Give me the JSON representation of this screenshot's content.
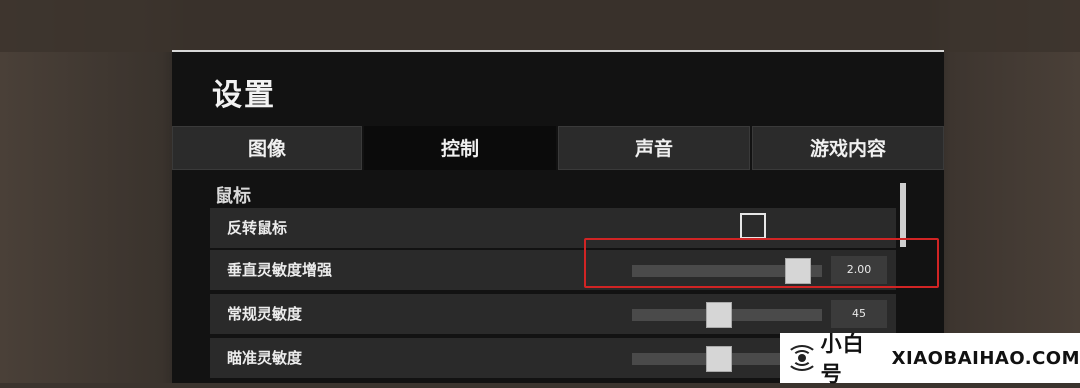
{
  "window": {
    "title": "设置"
  },
  "tabs": [
    {
      "label": "图像"
    },
    {
      "label": "控制"
    },
    {
      "label": "声音"
    },
    {
      "label": "游戏内容"
    }
  ],
  "active_tab": "控制",
  "section": {
    "title": "鼠标"
  },
  "settings": [
    {
      "label": "反转鼠标",
      "type": "checkbox",
      "checked": false
    },
    {
      "label": "垂直灵敏度增强",
      "type": "slider",
      "value": "2.00",
      "fraction": 0.93
    },
    {
      "label": "常规灵敏度",
      "type": "slider",
      "value": "45",
      "fraction": 0.45
    },
    {
      "label": "瞄准灵敏度",
      "type": "slider",
      "value": "",
      "fraction": 0.45
    }
  ],
  "brand": {
    "name_cn": "小白号",
    "name_en": "XIAOBAIHAO.COM"
  },
  "colors": {
    "highlight": "#d12424",
    "panel": "#121212",
    "row": "#2a2a2a"
  }
}
